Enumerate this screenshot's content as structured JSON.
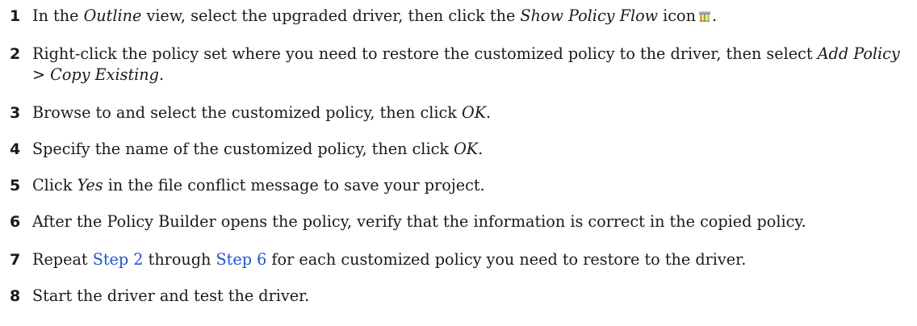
{
  "steps": [
    {
      "number": "1",
      "t1": "In the ",
      "i1": "Outline",
      "t2": " view, select the upgraded driver, then click the ",
      "i2": "Show Policy Flow",
      "t3": " icon",
      "t4": "."
    },
    {
      "number": "2",
      "t1": "Right-click the policy set where you need to restore the customized policy to the driver, then select ",
      "i1": "Add Policy > Copy Existing",
      "t2": "."
    },
    {
      "number": "3",
      "t1": "Browse to and select the customized policy, then click ",
      "i1": "OK",
      "t2": "."
    },
    {
      "number": "4",
      "t1": "Specify the name of the customized policy, then click ",
      "i1": "OK",
      "t2": "."
    },
    {
      "number": "5",
      "t1": "Click ",
      "i1": "Yes",
      "t2": " in the file conflict message to save your project."
    },
    {
      "number": "6",
      "t1": "After the Policy Builder opens the policy, verify that the information is correct in the copied policy."
    },
    {
      "number": "7",
      "t1": "Repeat ",
      "link1": "Step 2",
      "t2": " through ",
      "link2": "Step 6",
      "t3": " for each customized policy you need to restore to the driver."
    },
    {
      "number": "8",
      "t1": "Start the driver and test the driver."
    }
  ],
  "icons": {
    "step1_icon": "show-policy-flow-icon"
  },
  "colors": {
    "link": "#2255cc",
    "text": "#1a1a1a"
  }
}
